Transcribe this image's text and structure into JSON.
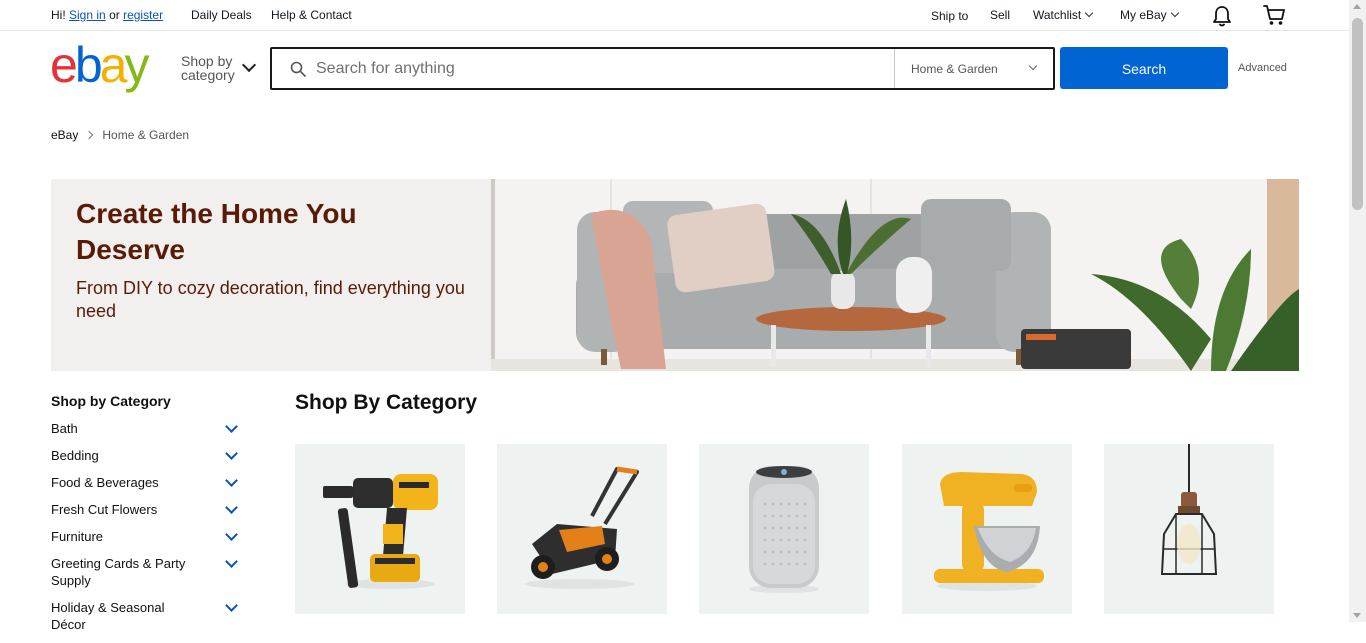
{
  "topbar": {
    "greeting_prefix": "Hi!",
    "sign_in": "Sign in",
    "or": "or",
    "register": "register",
    "daily_deals": "Daily Deals",
    "help_contact": "Help & Contact",
    "ship_to": "Ship to",
    "sell": "Sell",
    "watchlist": "Watchlist",
    "my_ebay": "My eBay",
    "notification_icon": "bell-icon",
    "cart_icon": "cart-icon"
  },
  "header": {
    "logo_text": "ebay",
    "shop_by_line1": "Shop by",
    "shop_by_line2": "category",
    "search_placeholder": "Search for anything",
    "search_value": "",
    "category_selected": "Home & Garden",
    "search_button": "Search",
    "advanced": "Advanced"
  },
  "breadcrumb": [
    "eBay",
    "Home & Garden"
  ],
  "hero": {
    "title": "Create the Home You Deserve",
    "subtitle": "From DIY to cozy decoration, find everything you need"
  },
  "sidebar": {
    "title": "Shop by Category",
    "items": [
      "Bath",
      "Bedding",
      "Food & Beverages",
      "Fresh Cut Flowers",
      "Furniture",
      "Greeting Cards & Party Supply",
      "Holiday & Seasonal Décor"
    ]
  },
  "main": {
    "title": "Shop By Category",
    "tiles": [
      "drill-image",
      "lawn-mower-image",
      "air-purifier-image",
      "stand-mixer-image",
      "pendant-lamp-image"
    ]
  },
  "colors": {
    "ebay_e": "#e53238",
    "ebay_b": "#0064d2",
    "ebay_a": "#f5af02",
    "ebay_y": "#86b817",
    "search_button": "#0064d2",
    "hero_text": "#5a1a06",
    "link": "#0654ba"
  }
}
